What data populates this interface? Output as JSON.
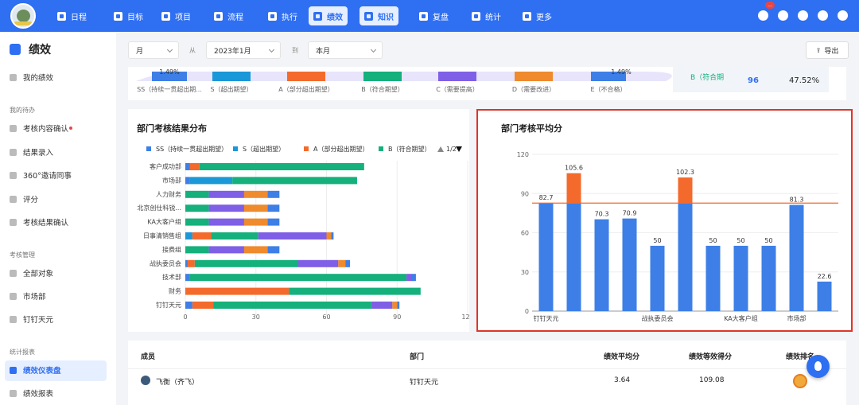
{
  "nav": {
    "items": [
      "日程",
      "目标",
      "项目",
      "流程",
      "执行",
      "绩效",
      "知识",
      "复盘",
      "统计",
      "更多"
    ],
    "active": [
      "绩效",
      "知识"
    ],
    "notify_count": "..."
  },
  "sidebar": {
    "title": "绩效",
    "my": "我的绩效",
    "sec1": "我的待办",
    "items1": [
      "考核内容确认",
      "结果录入",
      "360°邀请同事",
      "评分",
      "考核结果确认"
    ],
    "sec2": "考核管理",
    "items2": [
      "全部对象",
      "市场部",
      "钉钉天元"
    ],
    "sec3": "统计报表",
    "items3": [
      "绩效仪表盘",
      "绩效报表"
    ]
  },
  "filters": {
    "period": "月",
    "from_label": "从",
    "from": "2023年1月",
    "to_label": "到",
    "to": "本月",
    "export": "导出"
  },
  "top_strip": {
    "labels": [
      "SS（持续一贯超出期...",
      "S（超出期望）",
      "A（部分超出期望）",
      "B（符合期望）",
      "C（需要提高）",
      "D（需要改进）",
      "E（不合格）"
    ],
    "colors": [
      "#3d7fe6",
      "#1a98d8",
      "#f46a2c",
      "#15b07b",
      "#7f5fe6",
      "#ef8a2d",
      "#3d7fe6"
    ],
    "left_pct": "1.49%",
    "right_pct": "1.49%",
    "stat_label": "B（符合期望）",
    "stat_value": "96",
    "stat_pct": "47.52%"
  },
  "chart_data": [
    {
      "type": "bar",
      "orientation": "horizontal",
      "stacked": true,
      "title": "部门考核结果分布",
      "categories": [
        "客户成功部",
        "市场部",
        "人力财务",
        "北京创仕科锐...",
        "KA大客户组",
        "日事清销售组",
        "接费组",
        "战执委员会",
        "技术部",
        "财务",
        "钉钉天元"
      ],
      "series": [
        {
          "name": "SS（持续一贯超出期望）",
          "color": "#3d7fe6",
          "values": [
            2,
            2,
            0,
            0,
            0,
            0,
            0,
            1,
            2,
            0,
            3
          ]
        },
        {
          "name": "S（超出期望）",
          "color": "#1a98d8",
          "values": [
            0,
            18,
            0,
            0,
            0,
            3,
            0,
            0,
            0,
            0,
            0
          ]
        },
        {
          "name": "A（部分超出期望）",
          "color": "#f46a2c",
          "values": [
            4,
            0,
            0,
            0,
            0,
            8,
            0,
            3,
            0,
            44,
            9
          ]
        },
        {
          "name": "B（符合期望）",
          "color": "#15b07b",
          "values": [
            70,
            53,
            10,
            10,
            10,
            20,
            10,
            44,
            92,
            56,
            67
          ]
        },
        {
          "name": "C",
          "color": "#7f5fe6",
          "values": [
            0,
            0,
            15,
            15,
            15,
            29,
            15,
            17,
            2,
            0,
            9
          ]
        },
        {
          "name": "D",
          "color": "#ef8a2d",
          "values": [
            0,
            0,
            10,
            10,
            10,
            2,
            10,
            3,
            0,
            0,
            2
          ]
        },
        {
          "name": "E",
          "color": "#3d7fe6",
          "values": [
            0,
            0,
            5,
            5,
            5,
            1,
            5,
            2,
            2,
            0,
            1
          ]
        }
      ],
      "xlim": [
        0,
        120
      ],
      "xticks": [
        0,
        30,
        60,
        90,
        120
      ],
      "legend_page": "1/2"
    },
    {
      "type": "bar",
      "stacked": true,
      "title": "部门考核平均分",
      "categories": [
        "钉钉天元",
        "",
        "",
        "",
        "战执委员会",
        "",
        "",
        "KA大客户组",
        "",
        "市场部",
        ""
      ],
      "values": [
        82.7,
        105.6,
        70.3,
        70.9,
        50,
        102.3,
        50,
        50,
        50,
        81.3,
        22.6
      ],
      "base_color": "#3d7fe6",
      "overflow_color": "#f46a2c",
      "reference_line": 82.7,
      "ylim": [
        0,
        120
      ],
      "yticks": [
        0,
        30,
        60,
        90,
        120
      ]
    }
  ],
  "table": {
    "headers": [
      "成员",
      "部门",
      "绩效平均分",
      "绩效等效得分",
      "绩效排名"
    ],
    "row": {
      "member": "飞衡（齐飞）",
      "dept": "钉钉天元",
      "avg": "3.64",
      "eq": "109.08"
    }
  }
}
